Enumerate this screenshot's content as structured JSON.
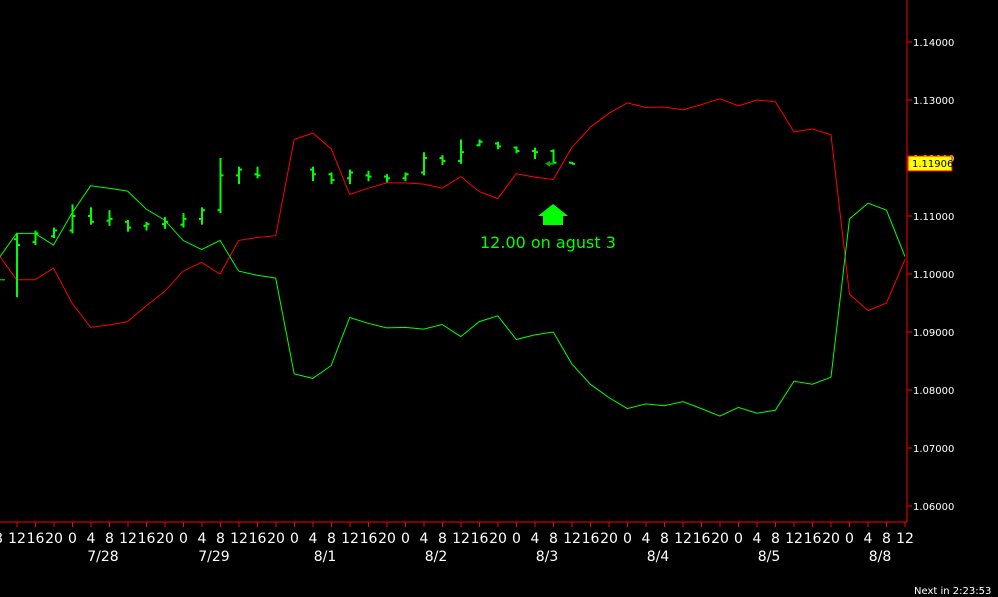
{
  "chart_data": {
    "type": "line",
    "price_axis": {
      "ticks": [
        {
          "value": 1.14,
          "label": "1.14000"
        },
        {
          "value": 1.13,
          "label": "1.13000"
        },
        {
          "value": 1.12,
          "label": "1.12000"
        },
        {
          "value": 1.11,
          "label": "1.11000"
        },
        {
          "value": 1.1,
          "label": "1.10000"
        },
        {
          "value": 1.09,
          "label": "1.09000"
        },
        {
          "value": 1.08,
          "label": "1.08000"
        },
        {
          "value": 1.07,
          "label": "1.07000"
        },
        {
          "value": 1.06,
          "label": "1.06000"
        }
      ],
      "ylim": [
        1.0555,
        1.1465
      ]
    },
    "time_axis": {
      "hour_labels": [
        "8",
        "12",
        "16",
        "20",
        "0",
        "4",
        "8",
        "12",
        "16",
        "20",
        "0",
        "4",
        "8",
        "12",
        "16",
        "20",
        "0",
        "4",
        "8",
        "12",
        "16",
        "20",
        "0",
        "4",
        "8",
        "12",
        "16",
        "20",
        "0",
        "4",
        "8",
        "12",
        "16",
        "20",
        "0",
        "4",
        "8",
        "12",
        "16",
        "20",
        "0",
        "4",
        "8",
        "12",
        "16",
        "20",
        "0",
        "4",
        "8",
        "12",
        "16",
        "20",
        "0",
        "4",
        "8",
        "12",
        "16",
        "20",
        "0",
        "4",
        "8",
        "12",
        "16",
        "20",
        "0",
        "4",
        "8",
        "12",
        "16",
        "20",
        "0",
        "4",
        "8",
        "12",
        "16",
        "20",
        "0",
        "4",
        "8"
      ],
      "date_labels": [
        {
          "label": "7/28",
          "index": 5
        },
        {
          "label": "7/29",
          "index": 11
        },
        {
          "label": "8/1",
          "index": 17
        },
        {
          "label": "8/2",
          "index": 23
        },
        {
          "label": "8/3",
          "index": 29
        },
        {
          "label": "8/4",
          "index": 35
        },
        {
          "label": "8/5",
          "index": 41
        },
        {
          "label": "8/8",
          "index": 47
        }
      ]
    },
    "current_price": {
      "value": 1.11906,
      "label": "1.11906",
      "color": "#ffff00"
    },
    "series": [
      {
        "color": "#ff0000",
        "values": [
          1.1035,
          1.099,
          1.099,
          1.101,
          1.095,
          1.0908,
          1.0912,
          1.0918,
          1.0945,
          1.097,
          1.1005,
          1.102,
          1.1,
          1.1058,
          1.1063,
          1.1066,
          1.1232,
          1.1243,
          1.1216,
          1.1137,
          1.1148,
          1.1157,
          1.1157,
          1.1155,
          1.1148,
          1.1168,
          1.1142,
          1.113,
          1.1173,
          1.1167,
          1.1163,
          1.1218,
          1.1253,
          1.1277,
          1.1295,
          1.1287,
          1.1288,
          1.1283,
          1.1292,
          1.1302,
          1.129,
          1.13,
          1.1297,
          1.1245,
          1.125,
          1.124,
          1.0965,
          1.0937,
          1.095,
          1.1025
        ]
      },
      {
        "color": "#00ff00",
        "values": [
          1.1025,
          1.107,
          1.107,
          1.105,
          1.1105,
          1.1152,
          1.1148,
          1.1143,
          1.1112,
          1.1093,
          1.1058,
          1.1042,
          1.1058,
          1.1005,
          1.0998,
          1.0993,
          1.0828,
          1.082,
          1.0842,
          1.0925,
          1.0915,
          1.0907,
          1.0908,
          1.0905,
          1.0913,
          1.0892,
          1.0918,
          1.0928,
          1.0887,
          1.0895,
          1.09,
          1.0845,
          1.081,
          1.0787,
          1.0768,
          1.0776,
          1.0773,
          1.078,
          1.0768,
          1.0755,
          1.077,
          1.076,
          1.0765,
          1.0815,
          1.081,
          1.0822,
          1.1095,
          1.1122,
          1.111,
          1.103
        ]
      },
      {
        "color": "#00ff00",
        "style": "bars",
        "values": [
          {
            "i": -1,
            "o": 1.099,
            "h": 1.099,
            "l": 1.099,
            "c": 1.099
          },
          {
            "i": 0,
            "o": 1.106,
            "h": 1.107,
            "l": 1.096,
            "c": 1.105
          },
          {
            "i": 1,
            "o": 1.1055,
            "h": 1.1075,
            "l": 1.105,
            "c": 1.107
          },
          {
            "i": 2,
            "o": 1.1065,
            "h": 1.108,
            "l": 1.1062,
            "c": 1.1075
          },
          {
            "i": 3,
            "o": 1.1075,
            "h": 1.112,
            "l": 1.107,
            "c": 1.11
          },
          {
            "i": 4,
            "o": 1.11,
            "h": 1.1115,
            "l": 1.1085,
            "c": 1.109
          },
          {
            "i": 5,
            "o": 1.1092,
            "h": 1.111,
            "l": 1.1083,
            "c": 1.1095
          },
          {
            "i": 6,
            "o": 1.109,
            "h": 1.1093,
            "l": 1.1073,
            "c": 1.108
          },
          {
            "i": 7,
            "o": 1.1083,
            "h": 1.109,
            "l": 1.1075,
            "c": 1.1086
          },
          {
            "i": 8,
            "o": 1.1086,
            "h": 1.1098,
            "l": 1.1078,
            "c": 1.109
          },
          {
            "i": 9,
            "o": 1.1085,
            "h": 1.1105,
            "l": 1.108,
            "c": 1.1095
          },
          {
            "i": 10,
            "o": 1.1095,
            "h": 1.1115,
            "l": 1.1085,
            "c": 1.111
          },
          {
            "i": 11,
            "o": 1.111,
            "h": 1.12,
            "l": 1.1105,
            "c": 1.117
          },
          {
            "i": 12,
            "o": 1.117,
            "h": 1.1185,
            "l": 1.1155,
            "c": 1.118
          },
          {
            "i": 13,
            "o": 1.1172,
            "h": 1.1185,
            "l": 1.1165,
            "c": 1.117
          },
          {
            "i": 16,
            "o": 1.118,
            "h": 1.1185,
            "l": 1.116,
            "c": 1.1172
          },
          {
            "i": 17,
            "o": 1.1172,
            "h": 1.1175,
            "l": 1.1155,
            "c": 1.1162
          },
          {
            "i": 18,
            "o": 1.1165,
            "h": 1.118,
            "l": 1.1155,
            "c": 1.1175
          },
          {
            "i": 19,
            "o": 1.117,
            "h": 1.1178,
            "l": 1.116,
            "c": 1.1168
          },
          {
            "i": 20,
            "o": 1.1168,
            "h": 1.1172,
            "l": 1.1158,
            "c": 1.1165
          },
          {
            "i": 21,
            "o": 1.1165,
            "h": 1.1175,
            "l": 1.116,
            "c": 1.1172
          },
          {
            "i": 22,
            "o": 1.1175,
            "h": 1.121,
            "l": 1.117,
            "c": 1.12
          },
          {
            "i": 23,
            "o": 1.12,
            "h": 1.1205,
            "l": 1.1188,
            "c": 1.1195
          },
          {
            "i": 24,
            "o": 1.1195,
            "h": 1.1232,
            "l": 1.119,
            "c": 1.121
          },
          {
            "i": 25,
            "o": 1.1222,
            "h": 1.1232,
            "l": 1.122,
            "c": 1.1228
          },
          {
            "i": 26,
            "o": 1.1225,
            "h": 1.1228,
            "l": 1.1215,
            "c": 1.122
          },
          {
            "i": 27,
            "o": 1.1218,
            "h": 1.122,
            "l": 1.1208,
            "c": 1.1212
          },
          {
            "i": 28,
            "o": 1.1212,
            "h": 1.1218,
            "l": 1.1198,
            "c": 1.121
          },
          {
            "i": 29,
            "o": 1.1212,
            "h": 1.1215,
            "l": 1.119,
            "c": 1.1192
          },
          {
            "i": 30,
            "o": 1.1192,
            "h": 1.1193,
            "l": 1.119,
            "c": 1.119
          }
        ]
      }
    ],
    "annotation": {
      "text": "12.00 on agust 3",
      "color": "#00ff00",
      "marker": "up-arrow-icon"
    }
  },
  "footer": {
    "next_bar": "Next in 2:23:53"
  }
}
